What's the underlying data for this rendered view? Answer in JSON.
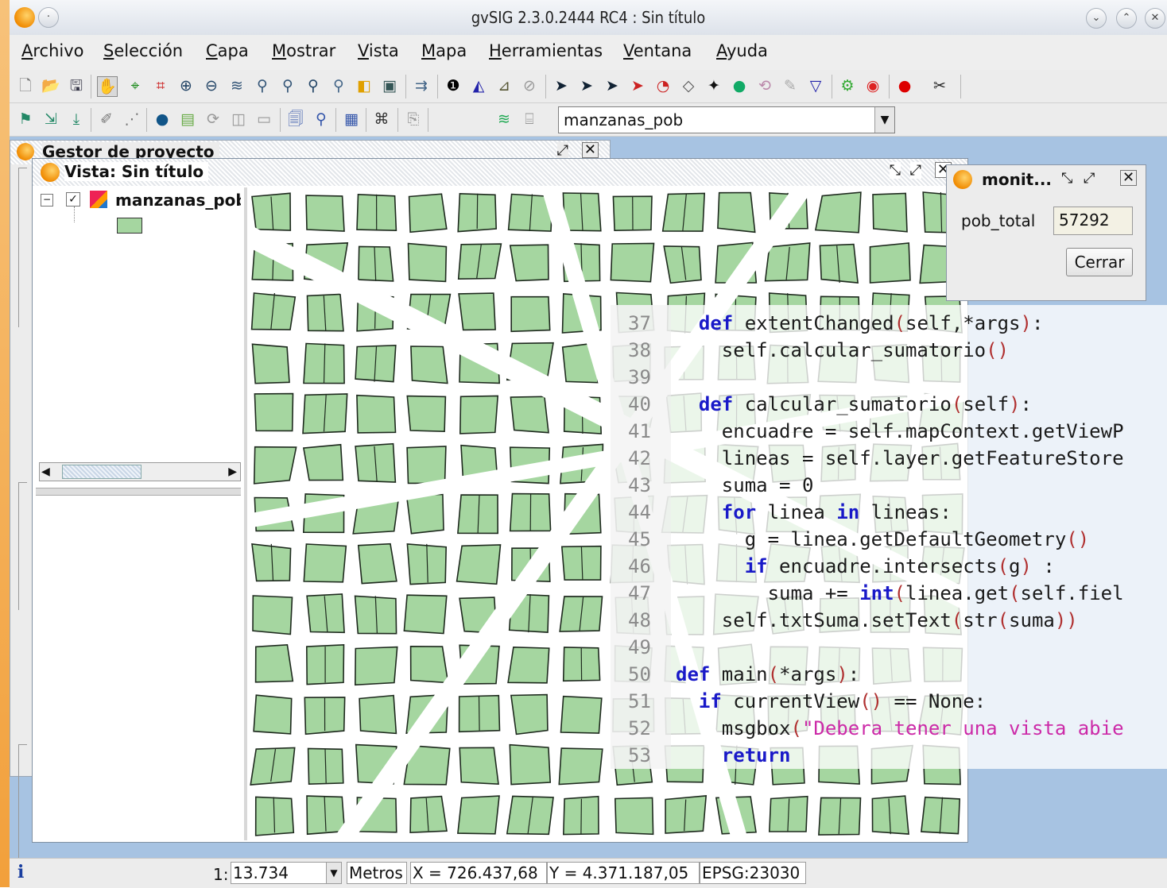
{
  "window": {
    "title": "gvSIG 2.3.0.2444 RC4 : Sin título",
    "controls": [
      "⌄",
      "⌃",
      "✕"
    ]
  },
  "menu": [
    "Archivo",
    "Selección",
    "Capa",
    "Mostrar",
    "Vista",
    "Mapa",
    "Herramientas",
    "Ventana",
    "Ayuda"
  ],
  "toolbar": {
    "layer_select": "manzanas_pob"
  },
  "project_manager": {
    "title": "Gestor de proyecto"
  },
  "vista": {
    "title": "Vista: Sin título",
    "layer_name": "manzanas_pob",
    "layer_fill": "#a5d6a0"
  },
  "monitor": {
    "title": "monit...",
    "field_label": "pob_total",
    "field_value": "57292",
    "close_label": "Cerrar"
  },
  "code": {
    "lines": [
      {
        "n": "37",
        "code": "  def extentChanged(self,*args):"
      },
      {
        "n": "38",
        "code": "    self.calcular_sumatorio()"
      },
      {
        "n": "39",
        "code": ""
      },
      {
        "n": "40",
        "code": "  def calcular_sumatorio(self):"
      },
      {
        "n": "41",
        "code": "    encuadre = self.mapContext.getViewP"
      },
      {
        "n": "42",
        "code": "    lineas = self.layer.getFeatureStore"
      },
      {
        "n": "43",
        "code": "    suma = 0"
      },
      {
        "n": "44",
        "code": "    for linea in lineas:"
      },
      {
        "n": "45",
        "code": "      g = linea.getDefaultGeometry()"
      },
      {
        "n": "46",
        "code": "      if encuadre.intersects(g) :"
      },
      {
        "n": "47",
        "code": "        suma += int(linea.get(self.fiel"
      },
      {
        "n": "48",
        "code": "    self.txtSuma.setText(str(suma))"
      },
      {
        "n": "49",
        "code": ""
      },
      {
        "n": "50",
        "code": "def main(*args):"
      },
      {
        "n": "51",
        "code": "  if currentView() == None:"
      },
      {
        "n": "52",
        "code": "    msgbox(\"Debera tener una vista abie"
      },
      {
        "n": "53",
        "code": "    return"
      }
    ]
  },
  "status": {
    "scale_prefix": "1:",
    "scale": "13.734",
    "units": "Metros",
    "x": "X = 726.437,68",
    "y": "Y = 4.371.187,05",
    "epsg": "EPSG:23030",
    "info_icon": "i"
  }
}
